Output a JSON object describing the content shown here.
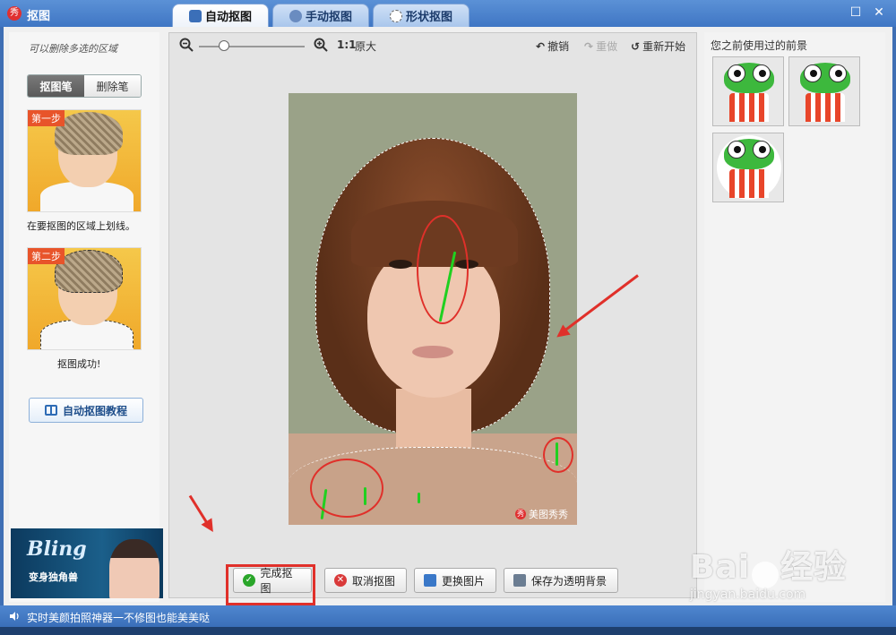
{
  "window": {
    "title": "抠图",
    "app_icon_text": "秀",
    "tabs": [
      {
        "label": "自动抠图",
        "active": true
      },
      {
        "label": "手动抠图",
        "active": false
      },
      {
        "label": "形状抠图",
        "active": false
      }
    ],
    "maximize_glyph": "☐",
    "close_glyph": "✕"
  },
  "left": {
    "hint": "可以删除多选的区域",
    "pen_tabs": [
      "抠图笔",
      "删除笔"
    ],
    "step1": {
      "tag": "第一步",
      "caption": "在要抠图的区域上划线。"
    },
    "step2": {
      "tag": "第二步",
      "caption": "抠图成功!"
    },
    "tutorial_label": "自动抠图教程",
    "ad": {
      "title": "Bling",
      "subtitle": "变身独角兽"
    }
  },
  "toolbar": {
    "ratio": "1:1",
    "ratio_label": "原大",
    "undo": "撤销",
    "redo": "重做",
    "restart": "重新开始"
  },
  "photo": {
    "watermark": "美图秀秀",
    "watermark_icon": "秀"
  },
  "actions": {
    "finish": "完成抠图",
    "cancel": "取消抠图",
    "replace": "更换图片",
    "save_transparent": "保存为透明背景"
  },
  "right": {
    "title": "您之前使用过的前景",
    "thumb_count": 3
  },
  "status": {
    "text": "实时美颜拍照神器一不修图也能美美哒"
  },
  "watermark": {
    "logo_left": "Bai",
    "logo_right": "经验",
    "url": "jingyan.baidu.com"
  },
  "colors": {
    "accent_red": "#e0302a",
    "title_blue": "#3f76c4",
    "stroke_green": "#20d020"
  }
}
